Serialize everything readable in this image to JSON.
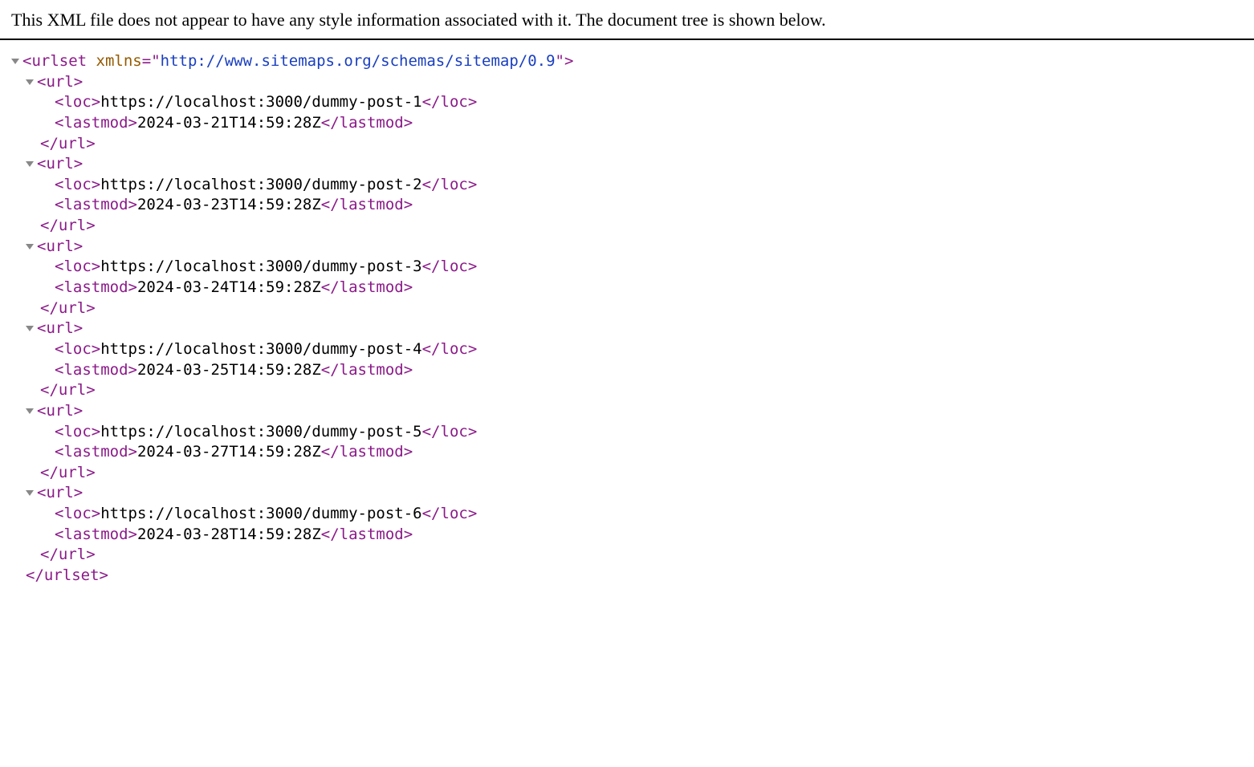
{
  "header_message": "This XML file does not appear to have any style information associated with it. The document tree is shown below.",
  "root": {
    "tag": "urlset",
    "attr_name": "xmlns",
    "attr_value": "http://www.sitemaps.org/schemas/sitemap/0.9"
  },
  "urls": [
    {
      "loc": "https://localhost:3000/dummy-post-1",
      "lastmod": "2024-03-21T14:59:28Z"
    },
    {
      "loc": "https://localhost:3000/dummy-post-2",
      "lastmod": "2024-03-23T14:59:28Z"
    },
    {
      "loc": "https://localhost:3000/dummy-post-3",
      "lastmod": "2024-03-24T14:59:28Z"
    },
    {
      "loc": "https://localhost:3000/dummy-post-4",
      "lastmod": "2024-03-25T14:59:28Z"
    },
    {
      "loc": "https://localhost:3000/dummy-post-5",
      "lastmod": "2024-03-27T14:59:28Z"
    },
    {
      "loc": "https://localhost:3000/dummy-post-6",
      "lastmod": "2024-03-28T14:59:28Z"
    }
  ],
  "child_tags": {
    "url": "url",
    "loc": "loc",
    "lastmod": "lastmod"
  }
}
